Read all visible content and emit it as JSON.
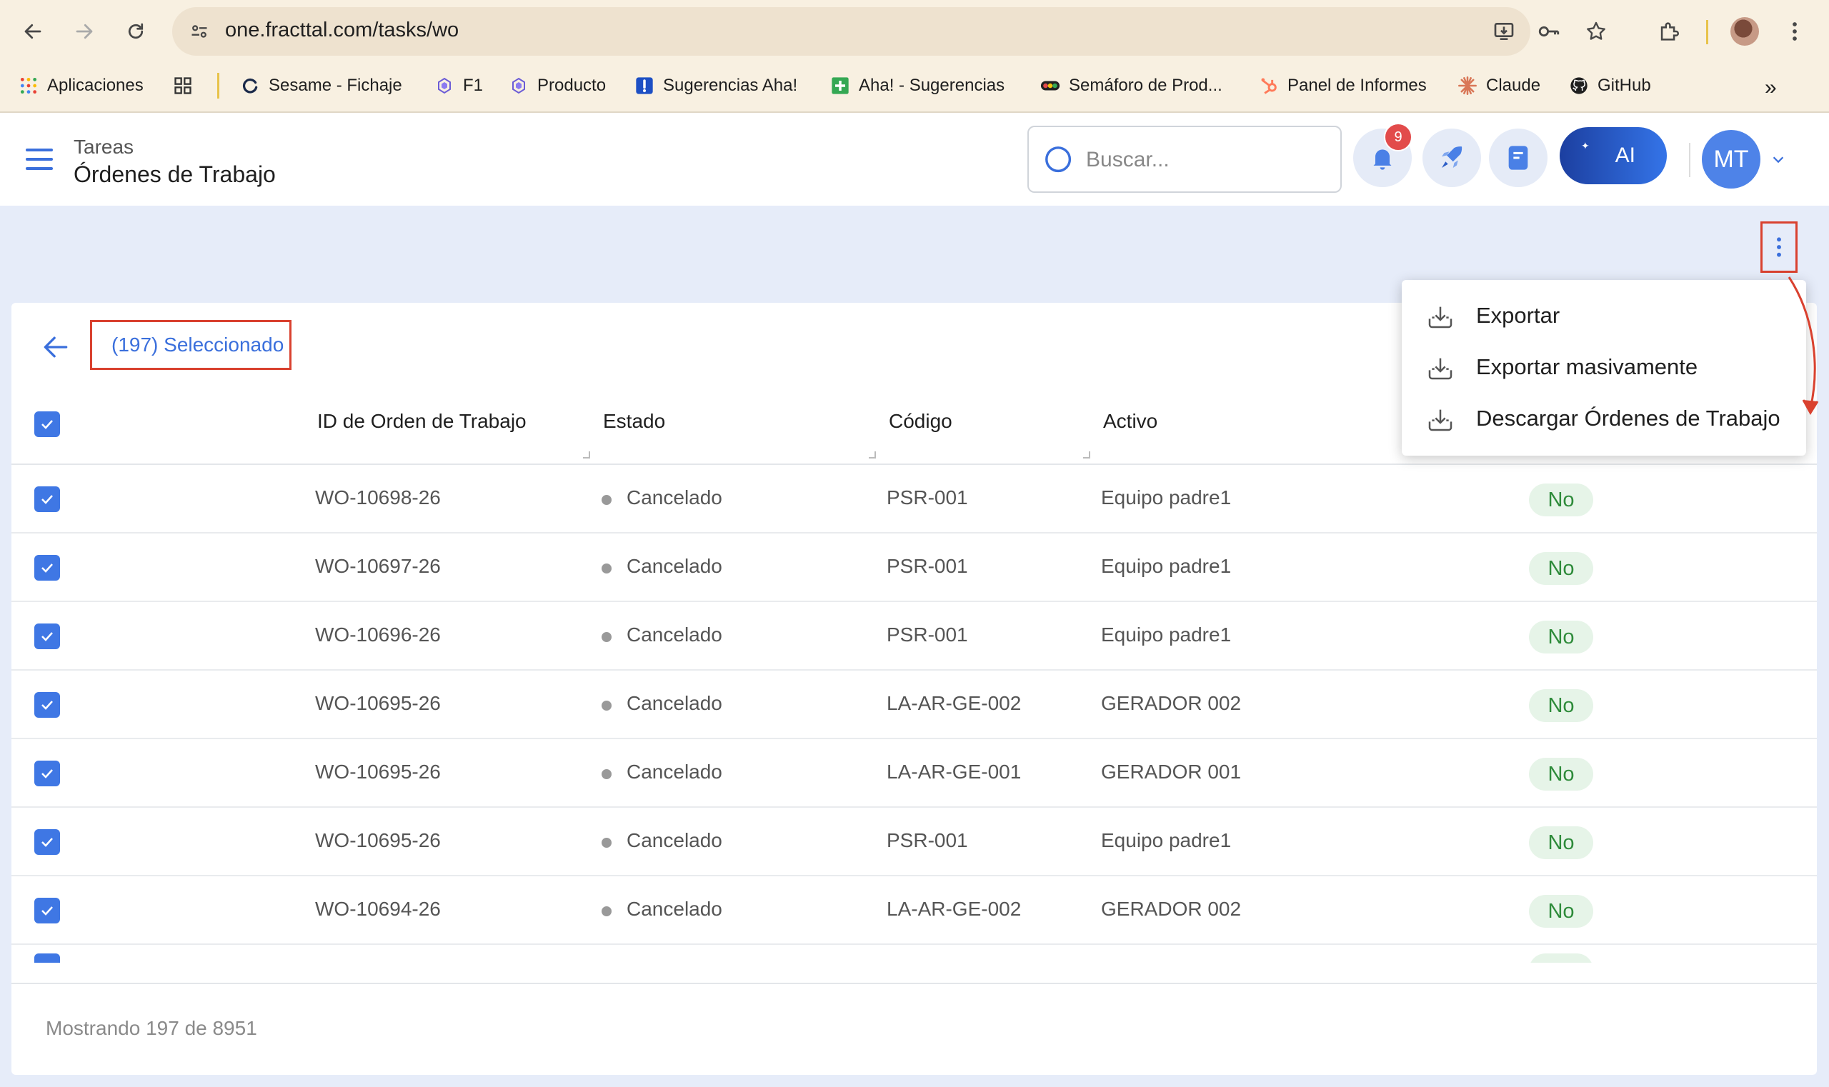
{
  "browser": {
    "url": "one.fracttal.com/tasks/wo",
    "bookmarks": [
      "Aplicaciones",
      "Sesame - Fichaje",
      "F1",
      "Producto",
      "Sugerencias Aha!",
      "Aha! - Sugerencias",
      "Semáforo de Prod...",
      "Panel de Informes",
      "Claude",
      "GitHub"
    ]
  },
  "header": {
    "section": "Tareas",
    "title": "Órdenes de Trabajo",
    "search_placeholder": "Buscar...",
    "notification_count": "9",
    "ai_label": "AI",
    "avatar_initials": "MT"
  },
  "selection": {
    "label": "(197) Seleccionado"
  },
  "table": {
    "columns": [
      "ID de Orden de Trabajo",
      "Estado",
      "Código",
      "Activo"
    ],
    "rows": [
      {
        "id": "WO-10698-26",
        "estado": "Cancelado",
        "codigo": "PSR-001",
        "activo": "Equipo padre1",
        "flag": "No"
      },
      {
        "id": "WO-10697-26",
        "estado": "Cancelado",
        "codigo": "PSR-001",
        "activo": "Equipo padre1",
        "flag": "No"
      },
      {
        "id": "WO-10696-26",
        "estado": "Cancelado",
        "codigo": "PSR-001",
        "activo": "Equipo padre1",
        "flag": "No"
      },
      {
        "id": "WO-10695-26",
        "estado": "Cancelado",
        "codigo": "LA-AR-GE-002",
        "activo": "GERADOR 002",
        "flag": "No"
      },
      {
        "id": "WO-10695-26",
        "estado": "Cancelado",
        "codigo": "LA-AR-GE-001",
        "activo": "GERADOR 001",
        "flag": "No"
      },
      {
        "id": "WO-10695-26",
        "estado": "Cancelado",
        "codigo": "PSR-001",
        "activo": "Equipo padre1",
        "flag": "No"
      },
      {
        "id": "WO-10694-26",
        "estado": "Cancelado",
        "codigo": "LA-AR-GE-002",
        "activo": "GERADOR 002",
        "flag": "No"
      }
    ]
  },
  "footer": {
    "showing": "Mostrando 197 de 8951"
  },
  "menu": {
    "items": [
      "Exportar",
      "Exportar masivamente",
      "Descargar Órdenes de Trabajo"
    ]
  },
  "colors": {
    "accent": "#3f77e4",
    "highlight": "#d9412f",
    "status_pill_bg": "#e6f4e8",
    "status_pill_text": "#2e8b3a"
  }
}
